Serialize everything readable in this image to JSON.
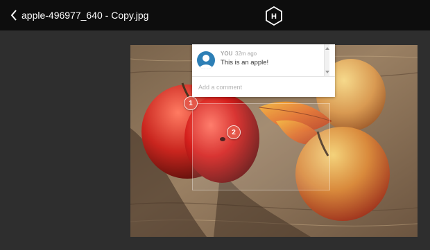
{
  "header": {
    "filename": "apple-496977_640 - Copy.jpg",
    "back_icon": "chevron-left-icon",
    "logo_letter": "H"
  },
  "markers": [
    {
      "number": "1"
    },
    {
      "number": "2"
    }
  ],
  "comment": {
    "author": "YOU",
    "time": "32m ago",
    "text": "This is an apple!",
    "input_placeholder": "Add a comment"
  },
  "colors": {
    "topbar": "#0d0d0d",
    "canvas": "#2e2e2e",
    "marker": "#e4584a",
    "avatar": "#2d7fb6"
  }
}
